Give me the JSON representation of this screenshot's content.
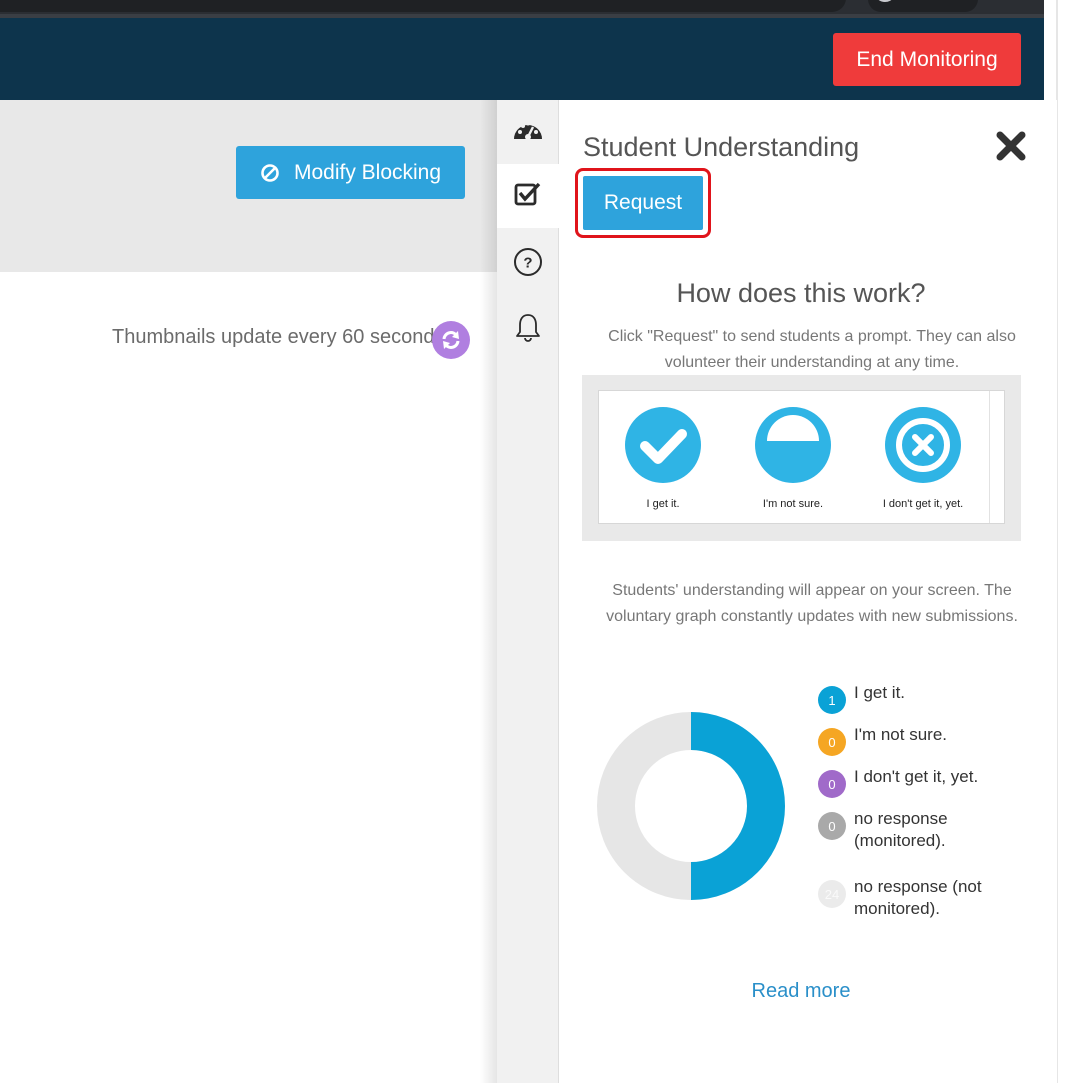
{
  "topbar": {
    "end_label": "End Monitoring"
  },
  "toolbar": {
    "modify_label": "Modify Blocking"
  },
  "thumbnails": {
    "text": "Thumbnails update every 60 seconds."
  },
  "rail": {
    "items": [
      "dashboard-icon",
      "checkbox-icon",
      "help-icon",
      "bell-icon"
    ],
    "active_index": 1
  },
  "panel": {
    "title": "Student Understanding",
    "request_label": "Request",
    "how_title": "How does this work?",
    "how_desc": "Click \"Request\" to send students a prompt. They can also volunteer their understanding at any time.",
    "options": [
      {
        "label": "I get it.",
        "icon": "check-circle-icon"
      },
      {
        "label": "I'm not sure.",
        "icon": "half-circle-icon"
      },
      {
        "label": "I don't get it, yet.",
        "icon": "x-circle-icon"
      }
    ],
    "students_desc": "Students' understanding will appear on your screen. The voluntary graph constantly updates with new submissions.",
    "legend": [
      {
        "count": "1",
        "label": "I get it.",
        "color": "#0aa2d6"
      },
      {
        "count": "0",
        "label": "I'm not sure.",
        "color": "#f5a623"
      },
      {
        "count": "0",
        "label": "I don't get it, yet.",
        "color": "#a06ac9"
      },
      {
        "count": "0",
        "label": "no response (monitored).",
        "color": "#a9a9a9"
      },
      {
        "count": "24",
        "label": "no response (not monitored).",
        "color": "#ebebeb"
      }
    ],
    "read_more": "Read more"
  },
  "colors": {
    "nav": "#0d344c",
    "accent_blue": "#2ea3dc",
    "end_red": "#ef3b3b",
    "refresh_purple": "#b07fe0",
    "highlight_red": "#e0141b"
  }
}
